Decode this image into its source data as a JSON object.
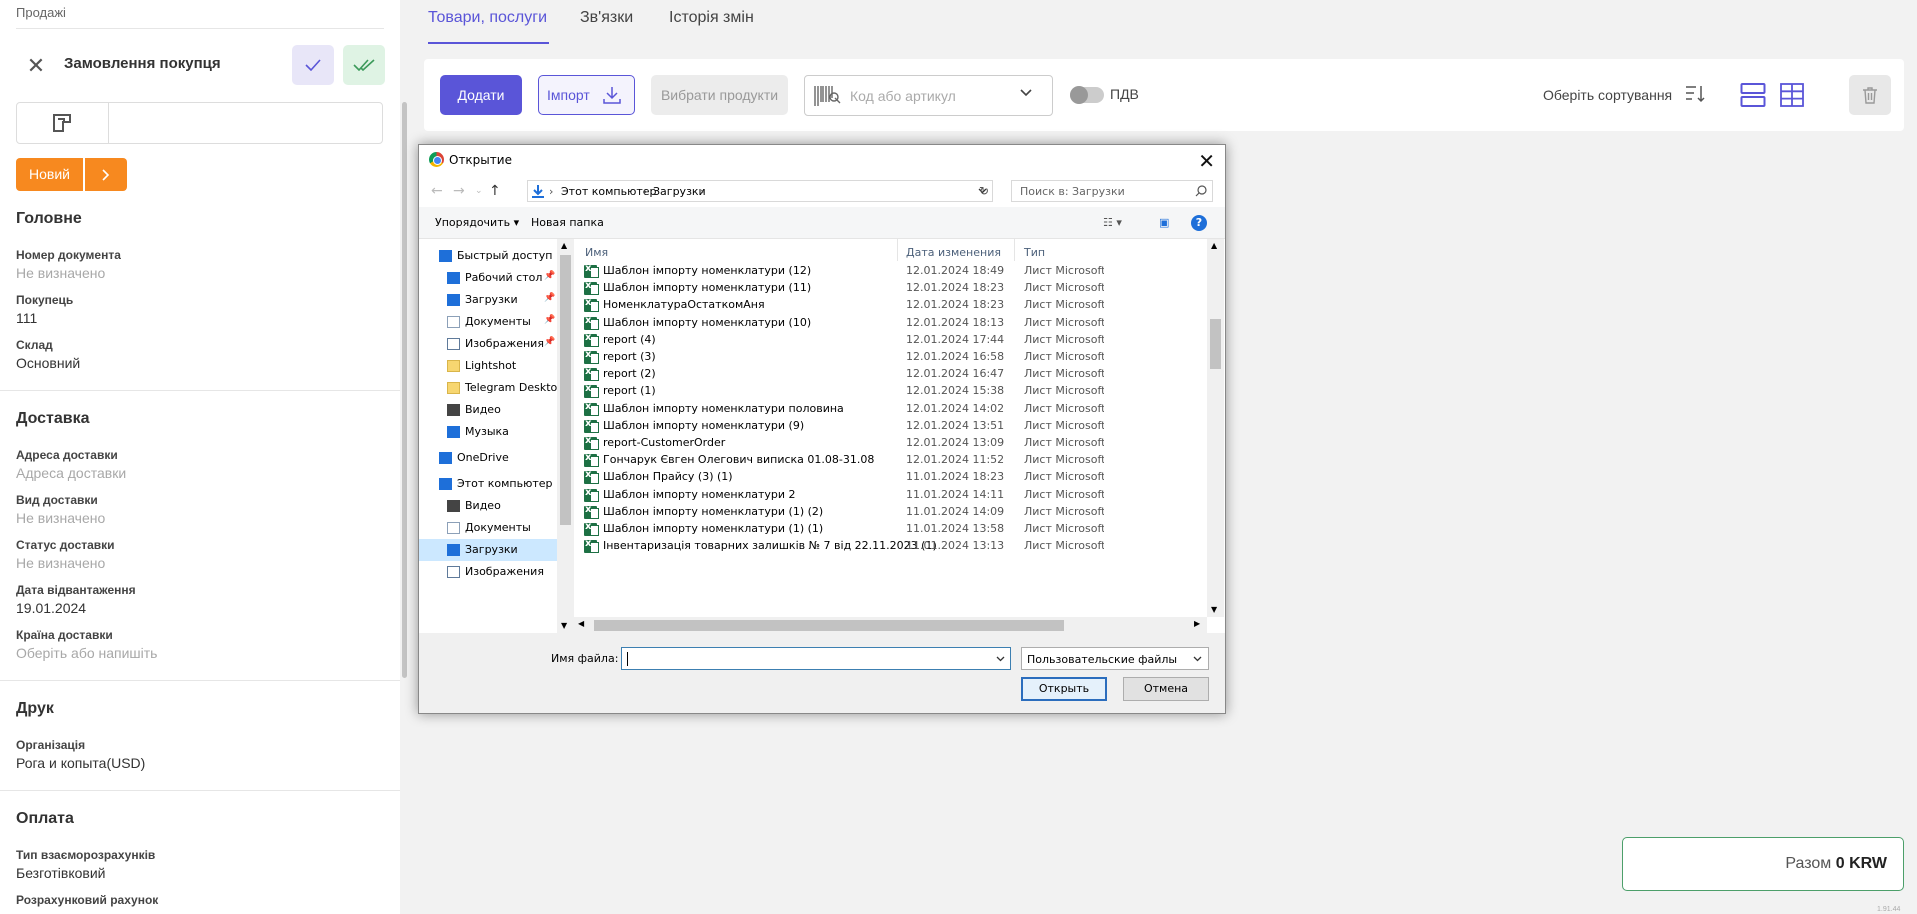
{
  "left": {
    "breadcrumb": "Продажі",
    "title": "Замовлення покупця",
    "status": "Новий",
    "sections": {
      "main": "Головне",
      "delivery": "Доставка",
      "print": "Друк",
      "payment": "Оплата"
    },
    "fields": {
      "doc_number_label": "Номер документа",
      "doc_number_value": "Не визначено",
      "buyer_label": "Покупець",
      "buyer_value": "111",
      "warehouse_label": "Склад",
      "warehouse_value": "Основний",
      "delivery_address_label": "Адреса доставки",
      "delivery_address_placeholder": "Адреса доставки",
      "delivery_type_label": "Вид доставки",
      "delivery_type_value": "Не визначено",
      "delivery_status_label": "Статус доставки",
      "delivery_status_value": "Не визначено",
      "ship_date_label": "Дата відвантаження",
      "ship_date_value": "19.01.2024",
      "country_label": "Країна доставки",
      "country_placeholder": "Оберіть або напишіть",
      "org_label": "Організація",
      "org_value": "Рога и копыта(USD)",
      "settlement_label": "Тип взаєморозрахунків",
      "settlement_value": "Безготівковий",
      "account_label": "Розрахунковий рахунок"
    }
  },
  "tabs": [
    "Товари, послуги",
    "Зв'язки",
    "Історія змін"
  ],
  "toolbar": {
    "add": "Додати",
    "import": "Імпорт",
    "select_products": "Вибрати продукти",
    "search_placeholder": "Код або артикул",
    "vat": "ПДВ",
    "sort": "Оберіть сортування"
  },
  "total": {
    "label": "Разом",
    "value": "0 KRW"
  },
  "version": "1.91.44",
  "dialog": {
    "title": "Открытие",
    "path": [
      "Этот компьютер",
      "Загрузки"
    ],
    "search_placeholder": "Поиск в: Загрузки",
    "organize": "Упорядочить",
    "new_folder": "Новая папка",
    "columns": {
      "name": "Имя",
      "date": "Дата изменения",
      "type": "Тип"
    },
    "tree": [
      {
        "label": "Быстрый доступ",
        "icon": "star-icon",
        "pin": false
      },
      {
        "label": "Рабочий стол",
        "icon": "desktop-icon",
        "pin": true
      },
      {
        "label": "Загрузки",
        "icon": "download-icon",
        "pin": true
      },
      {
        "label": "Документы",
        "icon": "document-icon",
        "pin": true
      },
      {
        "label": "Изображения",
        "icon": "image-icon",
        "pin": true
      },
      {
        "label": "Lightshot",
        "icon": "folder-icon",
        "pin": false
      },
      {
        "label": "Telegram Desktop",
        "icon": "folder-icon",
        "pin": false
      },
      {
        "label": "Видео",
        "icon": "video-icon",
        "pin": false
      },
      {
        "label": "Музыка",
        "icon": "music-icon",
        "pin": false
      },
      {
        "label": "OneDrive",
        "icon": "cloud-icon",
        "pin": false
      },
      {
        "label": "Этот компьютер",
        "icon": "computer-icon",
        "pin": false
      },
      {
        "label": "Видео",
        "icon": "video-icon",
        "pin": false
      },
      {
        "label": "Документы",
        "icon": "document-icon",
        "pin": false
      },
      {
        "label": "Загрузки",
        "icon": "download-icon",
        "pin": false
      },
      {
        "label": "Изображения",
        "icon": "image-icon",
        "pin": false
      }
    ],
    "files": [
      {
        "name": "Шаблон імпорту номенклатури (12)",
        "date": "12.01.2024 18:49",
        "type": "Лист Microsoft"
      },
      {
        "name": "Шаблон імпорту номенклатури (11)",
        "date": "12.01.2024 18:23",
        "type": "Лист Microsoft"
      },
      {
        "name": "НоменклатураОстаткомАня",
        "date": "12.01.2024 18:23",
        "type": "Лист Microsoft"
      },
      {
        "name": "Шаблон імпорту номенклатури (10)",
        "date": "12.01.2024 18:13",
        "type": "Лист Microsoft"
      },
      {
        "name": "report (4)",
        "date": "12.01.2024 17:44",
        "type": "Лист Microsoft"
      },
      {
        "name": "report (3)",
        "date": "12.01.2024 16:58",
        "type": "Лист Microsoft"
      },
      {
        "name": "report (2)",
        "date": "12.01.2024 16:47",
        "type": "Лист Microsoft"
      },
      {
        "name": "report (1)",
        "date": "12.01.2024 15:38",
        "type": "Лист Microsoft"
      },
      {
        "name": "Шаблон імпорту номенклатури половина",
        "date": "12.01.2024 14:02",
        "type": "Лист Microsoft"
      },
      {
        "name": "Шаблон імпорту номенклатури (9)",
        "date": "12.01.2024 13:51",
        "type": "Лист Microsoft"
      },
      {
        "name": "report-CustomerOrder",
        "date": "12.01.2024 13:09",
        "type": "Лист Microsoft"
      },
      {
        "name": "Гончарук Євген Олегович виписка 01.08-31.08",
        "date": "12.01.2024 11:52",
        "type": "Лист Microsoft"
      },
      {
        "name": "Шаблон Прайсу (3) (1)",
        "date": "11.01.2024 18:23",
        "type": "Лист Microsoft"
      },
      {
        "name": "Шаблон імпорту номенклатури 2",
        "date": "11.01.2024 14:11",
        "type": "Лист Microsoft"
      },
      {
        "name": "Шаблон імпорту номенклатури (1) (2)",
        "date": "11.01.2024 14:09",
        "type": "Лист Microsoft"
      },
      {
        "name": "Шаблон імпорту номенклатури (1) (1)",
        "date": "11.01.2024 13:58",
        "type": "Лист Microsoft"
      },
      {
        "name": "Інвентаризація товарних залишків № 7 від 22.11.2023  (1)",
        "date": "11.01.2024 13:13",
        "type": "Лист Microsoft"
      }
    ],
    "filename_label": "Имя файла:",
    "filename_value": "",
    "filetype": "Пользовательские файлы",
    "open": "Открыть",
    "cancel": "Отмена"
  }
}
